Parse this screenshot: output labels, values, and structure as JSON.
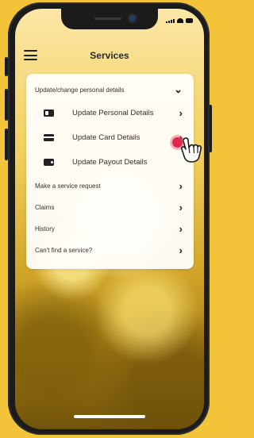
{
  "header": {
    "title": "Services"
  },
  "card": {
    "main_item": {
      "label": "Update/change personal details"
    },
    "sub_items": [
      {
        "label": "Update Personal Details",
        "icon": "id-card-icon"
      },
      {
        "label": "Update Card Details",
        "icon": "credit-card-icon"
      },
      {
        "label": "Update Payout Details",
        "icon": "wallet-icon"
      }
    ],
    "items": [
      {
        "label": "Make a service request"
      },
      {
        "label": "Claims"
      },
      {
        "label": "History"
      },
      {
        "label": "Can't find a service?"
      }
    ]
  },
  "colors": {
    "background": "#f3c43a",
    "highlight_dot": "#e0294a",
    "text": "#3a2e2e"
  }
}
